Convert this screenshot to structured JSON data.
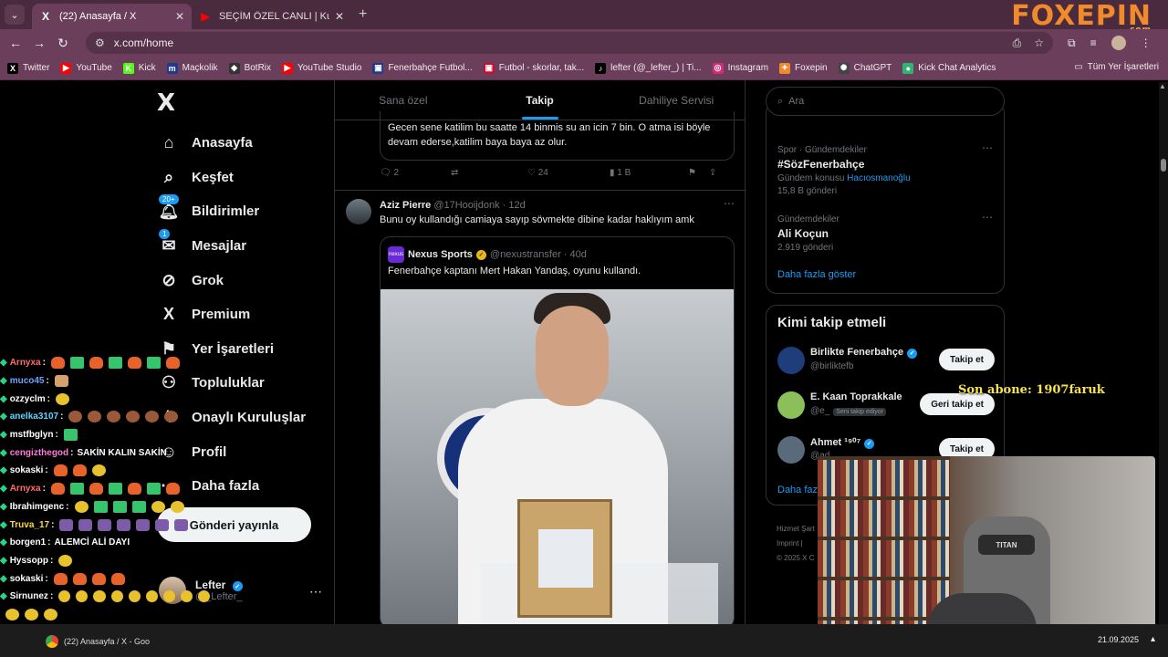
{
  "browser": {
    "tabs": [
      {
        "title": "(22) Anasayfa / X",
        "favicon": "x-logo-icon",
        "active": true
      },
      {
        "title": "SEÇİM ÖZEL CANLI | Kulüb",
        "favicon": "youtube-icon",
        "active": false
      }
    ],
    "address": "x.com/home",
    "brand": "FOXEPIN",
    "brand_sub": ".com",
    "bookmarks": [
      {
        "label": "Twitter",
        "icon": "x-logo-icon",
        "color": "#000000",
        "glyph": "X"
      },
      {
        "label": "YouTube",
        "icon": "youtube-icon",
        "color": "#ff0000",
        "glyph": "▶"
      },
      {
        "label": "Kick",
        "icon": "kick-icon",
        "color": "#53fc18",
        "glyph": "K"
      },
      {
        "label": "Maçkolik",
        "icon": "mackolik-icon",
        "color": "#1e3a8a",
        "glyph": "m"
      },
      {
        "label": "BotRix",
        "icon": "botrix-icon",
        "color": "#333333",
        "glyph": "◆"
      },
      {
        "label": "YouTube Studio",
        "icon": "youtube-studio-icon",
        "color": "#ff0000",
        "glyph": "▶"
      },
      {
        "label": "Fenerbahçe Futbol...",
        "icon": "fenerbahce-icon",
        "color": "#1e3a8a",
        "glyph": "▣"
      },
      {
        "label": "Futbol - skorlar, tak...",
        "icon": "flashscore-icon",
        "color": "#c8102e",
        "glyph": "▣"
      },
      {
        "label": "lefter (@_lefter_) | Ti...",
        "icon": "tiktok-icon",
        "color": "#000000",
        "glyph": "♪"
      },
      {
        "label": "Instagram",
        "icon": "instagram-icon",
        "color": "#d62976",
        "glyph": "◎"
      },
      {
        "label": "Foxepin",
        "icon": "foxepin-icon",
        "color": "#f08a2a",
        "glyph": "✦"
      },
      {
        "label": "ChatGPT",
        "icon": "chatgpt-icon",
        "color": "#444444",
        "glyph": "✺"
      },
      {
        "label": "Kick Chat Analytics",
        "icon": "kick-analytics-icon",
        "color": "#2bb673",
        "glyph": "●"
      }
    ],
    "all_bookmarks": "Tüm Yer İşaretleri"
  },
  "nav": {
    "items": [
      {
        "label": "Anasayfa",
        "icon": "home-icon",
        "glyph": "⌂",
        "badge": ""
      },
      {
        "label": "Keşfet",
        "icon": "search-icon",
        "glyph": "⌕",
        "badge": ""
      },
      {
        "label": "Bildirimler",
        "icon": "bell-icon",
        "glyph": "🔔︎",
        "badge": "20+"
      },
      {
        "label": "Mesajlar",
        "icon": "mail-icon",
        "glyph": "✉",
        "badge": "1"
      },
      {
        "label": "Grok",
        "icon": "grok-icon",
        "glyph": "⊘",
        "badge": ""
      },
      {
        "label": "Premium",
        "icon": "x-premium-icon",
        "glyph": "X",
        "badge": ""
      },
      {
        "label": "Yer İşaretleri",
        "icon": "bookmark-icon",
        "glyph": "⚑",
        "badge": ""
      },
      {
        "label": "Topluluklar",
        "icon": "communities-icon",
        "glyph": "⚇",
        "badge": ""
      },
      {
        "label": "Onaylı Kuruluşlar",
        "icon": "lightning-icon",
        "glyph": "ϟ",
        "badge": ""
      },
      {
        "label": "Profil",
        "icon": "person-icon",
        "glyph": "☺",
        "badge": ""
      },
      {
        "label": "Daha fazla",
        "icon": "more-circle-icon",
        "glyph": "⋯",
        "badge": ""
      }
    ],
    "post_button": "Gönderi yayınla",
    "profile": {
      "name": "Lefter",
      "handle": "@_Lefter_"
    }
  },
  "feed": {
    "tabs": [
      "Sana özel",
      "Takip",
      "Dahiliye Servisi"
    ],
    "active_tab": 1,
    "prev_quote_text": "Gecen sene katilim bu saatte 14 binmis su an icin 7 bin. O atma isi böyle devam ederse,katilim baya baya az olur.",
    "prev_actions": {
      "replies": "2",
      "reposts": "",
      "likes": "24",
      "views": "1 B"
    },
    "tweet": {
      "name": "Aziz Pierre",
      "handle": "@17Hooijdonk",
      "time": "· 12d",
      "text": "Bunu oy kullandığı camiaya sayıp sövmekte dibine kadar haklıyım amk",
      "quote": {
        "logo": "nexus",
        "name": "Nexus Sports",
        "handle": "@nexustransfer",
        "time": "· 40d",
        "text": "Fenerbahçe kaptanı Mert Hakan Yandaş, oyunu kullandı."
      }
    }
  },
  "right": {
    "search_placeholder": "Ara",
    "trends": [
      {
        "meta": "Spor · Gündemdekiler",
        "name": "#SözFenerbahçe",
        "sub": "Gündem konusu",
        "sub_link": "Hacıosmanoğlu",
        "count": "15,8 B gönderi"
      },
      {
        "meta": "Gündemdekiler",
        "name": "Ali Koçun",
        "sub": "",
        "sub_link": "",
        "count": "2.919 gönderi"
      }
    ],
    "trends_more": "Daha fazla göster",
    "who_title": "Kimi takip etmeli",
    "who": [
      {
        "name": "Birlikte Fenerbahçe",
        "handle": "@birliktefb",
        "tag": "",
        "button": "Takip et",
        "color": "#1f3d7a"
      },
      {
        "name": "E. Kaan Toprakkale",
        "handle": "@e_",
        "tag": "Seni takip ediyor",
        "button": "Geri takip et",
        "color": "#8bbf5a"
      },
      {
        "name": "Ahmet ¹⁹⁰⁷",
        "handle": "@ad",
        "tag": "",
        "button": "Takip et",
        "color": "#5a6a7a"
      }
    ],
    "who_more": "Daha faz",
    "footer": [
      "Hizmet Şart",
      "Imprint  |",
      "© 2025 X C"
    ]
  },
  "chat": [
    {
      "user": "Arnyxa",
      "color": "#ff6b6b",
      "msg": "",
      "emotes": [
        "cat",
        "grn",
        "cat",
        "grn",
        "cat",
        "grn",
        "cat"
      ]
    },
    {
      "user": "muco45",
      "color": "#6aa5ff",
      "msg": "",
      "emotes": [
        "dog"
      ]
    },
    {
      "user": "ozzyclm",
      "color": "#ffffff",
      "msg": "",
      "emotes": [
        "yel"
      ]
    },
    {
      "user": "anelka3107",
      "color": "#5dd6ff",
      "msg": "",
      "emotes": [
        "brn",
        "brn",
        "brn",
        "brn",
        "brn",
        "brn"
      ]
    },
    {
      "user": "mstfbglyn",
      "color": "#ffffff",
      "msg": "",
      "emotes": [
        "grn"
      ]
    },
    {
      "user": "cengizthegod",
      "color": "#ff7ad9",
      "msg": "SAKİN KALIN SAKİN",
      "emotes": []
    },
    {
      "user": "sokaski",
      "color": "#ffffff",
      "msg": "",
      "emotes": [
        "cat",
        "cat",
        "yel"
      ]
    },
    {
      "user": "Arnyxa",
      "color": "#ff6b6b",
      "msg": "",
      "emotes": [
        "cat",
        "grn",
        "cat",
        "grn",
        "cat",
        "grn",
        "cat"
      ]
    },
    {
      "user": "Ibrahimgenc",
      "color": "#ffffff",
      "msg": "",
      "emotes": [
        "yel",
        "grn",
        "grn",
        "grn",
        "yel",
        "yel"
      ]
    },
    {
      "user": "Truva_17",
      "color": "#ffd93b",
      "msg": "",
      "emotes": [
        "pur",
        "pur",
        "pur",
        "pur",
        "pur",
        "pur",
        "pur"
      ]
    },
    {
      "user": "borgen1",
      "color": "#ffffff",
      "msg": "ALEMCİ ALİ DAYI",
      "emotes": []
    },
    {
      "user": "Hyssopp",
      "color": "#ffffff",
      "msg": "",
      "emotes": [
        "yel"
      ]
    },
    {
      "user": "sokaski",
      "color": "#ffffff",
      "msg": "",
      "emotes": [
        "cat",
        "cat",
        "cat",
        "cat"
      ]
    },
    {
      "user": "Sirnunez",
      "color": "#ffffff",
      "msg": "",
      "emotes": [
        "yel",
        "yel",
        "yel",
        "yel",
        "yel",
        "yel",
        "yel",
        "yel",
        "yel"
      ]
    },
    {
      "user": "",
      "color": "#ffffff",
      "msg": "",
      "emotes": [
        "yel",
        "yel",
        "yel"
      ]
    },
    {
      "user": "Arnyxa",
      "color": "#ff6b6b",
      "msg": "",
      "emotes": [
        "cat",
        "grn",
        "cat",
        "grn",
        "cat",
        "grn",
        "cat"
      ]
    }
  ],
  "overlay": {
    "last_sub": "Son abone: 1907faruk",
    "chair_brand": "TITAN"
  },
  "taskbar": {
    "item": "(22) Anasayfa / X - Goo",
    "date": "21.09.2025"
  }
}
